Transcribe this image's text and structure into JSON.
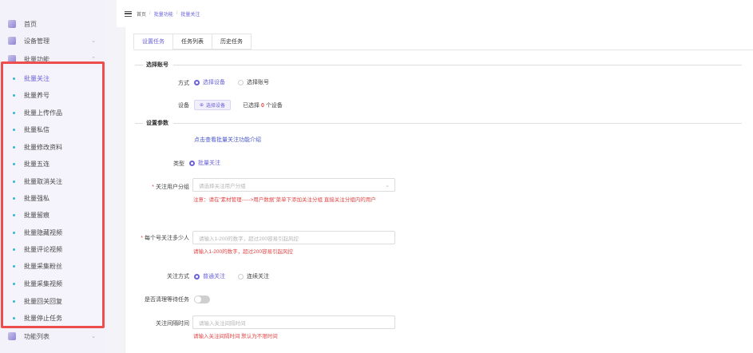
{
  "sidebar": {
    "top_items": [
      {
        "label": "首页",
        "icon": "home-icon"
      },
      {
        "label": "设备管理",
        "icon": "device-icon"
      },
      {
        "label": "批量功能",
        "icon": "batch-icon"
      }
    ],
    "sub_items": [
      {
        "label": "批量关注",
        "active": true
      },
      {
        "label": "批量养号"
      },
      {
        "label": "批量上传作品"
      },
      {
        "label": "批量私信"
      },
      {
        "label": "批量修改资料"
      },
      {
        "label": "批量五连"
      },
      {
        "label": "批量取消关注"
      },
      {
        "label": "批量强私"
      },
      {
        "label": "批量留痕"
      },
      {
        "label": "批量隐藏视频"
      },
      {
        "label": "批量评论视频"
      },
      {
        "label": "批量采集粉丝"
      },
      {
        "label": "批量采集视频"
      },
      {
        "label": "批量回关回复"
      },
      {
        "label": "批量停止任务"
      }
    ],
    "bottom_items": [
      {
        "label": "功能列表",
        "icon": "function-list-icon"
      }
    ],
    "highlight_color": "#ee4d4d",
    "accent_color": "#6a63d8",
    "dot_color": "#35b7c8"
  },
  "breadcrumb": [
    "首页",
    "批量功能",
    "批量关注"
  ],
  "tabs": [
    {
      "label": "设置任务",
      "active": true
    },
    {
      "label": "任务列表"
    },
    {
      "label": "历史任务"
    }
  ],
  "form": {
    "section_account": "选择账号",
    "mode_label": "方式",
    "mode_options": [
      "选择设备",
      "选择账号"
    ],
    "device_label": "设备",
    "select_device_btn": "选择设备",
    "selected_prefix": "已选择",
    "selected_count": "0",
    "selected_suffix": "个设备",
    "section_params": "设置参数",
    "intro_link": "点击查看批量关注功能介绍",
    "type_label": "类型",
    "type_option": "批量关注",
    "group_label": "关注用户分组",
    "group_placeholder": "请选择关注用户分组",
    "group_hint": "注意：请在“素材管理----->用户数据”菜单下添加关注分组 直接关注分组内的用户",
    "count_label": "每个号关注多少人",
    "count_placeholder": "请输入1-200的数字，超过200容易引起风控",
    "count_hint": "请输入1-200的数字，超过200容易引起风控",
    "follow_way_label": "关注方式",
    "follow_way_options": [
      "普通关注",
      "连续关注"
    ],
    "clear_wait_label": "是否清理等待任务",
    "interval_label": "关注间隔时间",
    "interval_placeholder": "请输入关注间隔时间",
    "interval_hint": "请输入关注间隔时间 默认为不限时间"
  }
}
